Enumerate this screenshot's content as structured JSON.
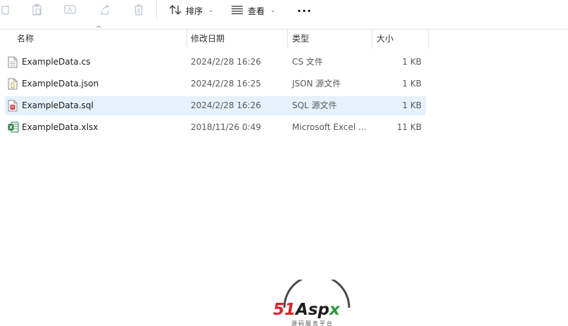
{
  "toolbar": {
    "sort_label": "排序",
    "view_label": "查看",
    "more_label": "···"
  },
  "columns": {
    "name": "名称",
    "modified": "修改日期",
    "type": "类型",
    "size": "大小"
  },
  "files": [
    {
      "name": "ExampleData.cs",
      "modified": "2024/2/28 16:26",
      "type": "CS 文件",
      "size": "1 KB",
      "icon": "cs-file-icon",
      "selected": false
    },
    {
      "name": "ExampleData.json",
      "modified": "2024/2/28 16:25",
      "type": "JSON 源文件",
      "size": "1 KB",
      "icon": "json-file-icon",
      "selected": false
    },
    {
      "name": "ExampleData.sql",
      "modified": "2024/2/28 16:26",
      "type": "SQL 源文件",
      "size": "1 KB",
      "icon": "sql-file-icon",
      "selected": true
    },
    {
      "name": "ExampleData.xlsx",
      "modified": "2018/11/26 0:49",
      "type": "Microsoft Excel ...",
      "size": "11 KB",
      "icon": "excel-file-icon",
      "selected": false
    }
  ],
  "watermark": {
    "brand_51": "51",
    "brand_asp": "Asp",
    "brand_x": "x",
    "subtitle": "源码服务平台"
  },
  "colors": {
    "selected_row": "#e5f1fb",
    "disabled_icon": "#b8c4d4",
    "excel_green": "#1d7a3f",
    "sql_red": "#c8414b"
  }
}
